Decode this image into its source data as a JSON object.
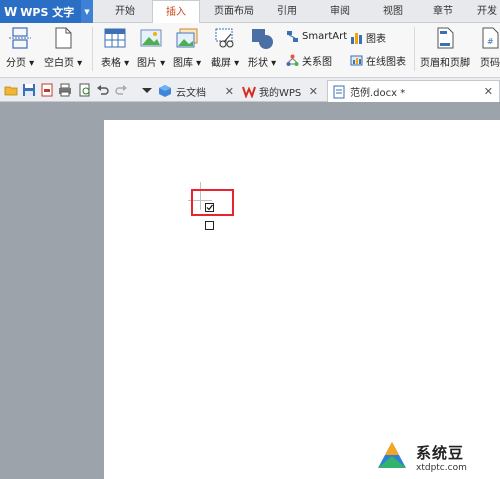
{
  "app": {
    "name": "WPS 文字"
  },
  "menu": {
    "tabs": [
      "开始",
      "插入",
      "页面布局",
      "引用",
      "审阅",
      "视图",
      "章节",
      "开发"
    ],
    "active_tab": "插入"
  },
  "ribbon": {
    "page_break": "分页",
    "blank_page": "空白页",
    "table": "表格",
    "picture": "图片",
    "gallery": "图库",
    "screenshot": "截屏",
    "shapes": "形状",
    "smartart": "SmartArt",
    "chart": "图表",
    "relation": "关系图",
    "online_chart": "在线图表",
    "header_footer": "页眉和页脚",
    "page_number": "页码"
  },
  "doc_tabs": [
    {
      "label": "云文档"
    },
    {
      "label": "我的WPS"
    },
    {
      "label": "范例.docx *"
    }
  ],
  "document": {
    "checkbox_checked_glyph": "☑",
    "checkbox_empty_glyph": "☐"
  },
  "watermark": {
    "title": "系统豆",
    "url": "xtdptc.com"
  },
  "colors": {
    "brand": "#2b6fc5",
    "active_tab_text": "#c94a1c",
    "highlight": "#e8252e"
  }
}
